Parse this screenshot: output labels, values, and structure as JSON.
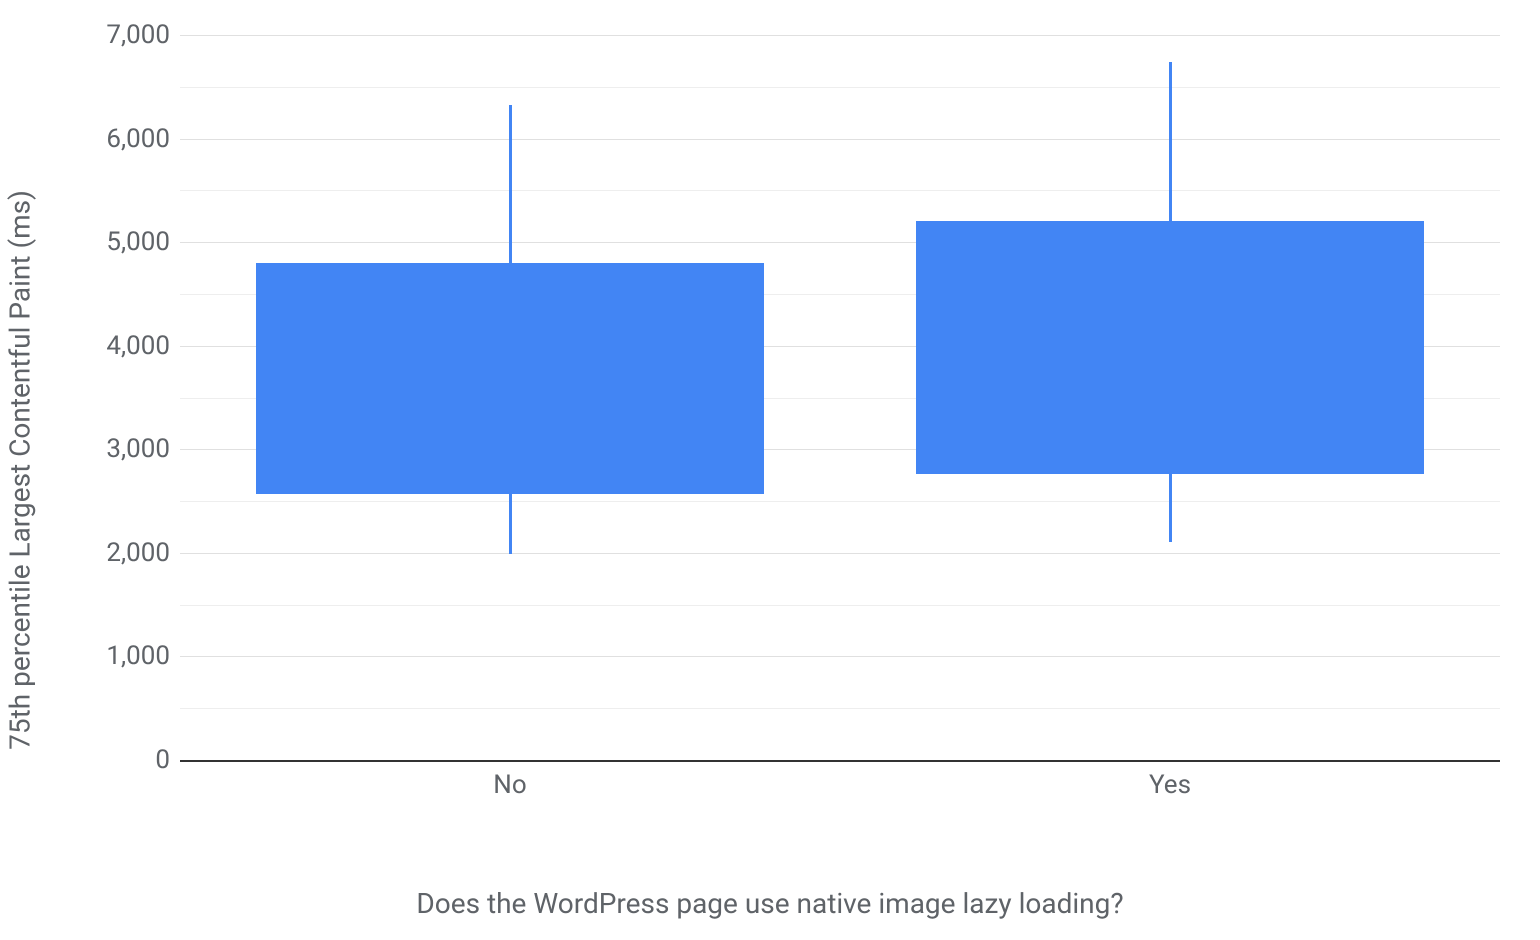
{
  "chart_data": {
    "type": "box",
    "ylabel": "75th percentile Largest Contentful Paint (ms)",
    "xlabel": "Does the WordPress page use native image lazy loading?",
    "categories": [
      "No",
      "Yes"
    ],
    "series": [
      {
        "name": "No",
        "low": 1990,
        "q1": 2570,
        "q3": 4800,
        "high": 6320
      },
      {
        "name": "Yes",
        "low": 2100,
        "q1": 2760,
        "q3": 5200,
        "high": 6740
      }
    ],
    "ylim": [
      0,
      7000
    ],
    "y_ticks_major": [
      0,
      1000,
      2000,
      3000,
      4000,
      5000,
      6000,
      7000
    ],
    "y_ticks_minor": [
      500,
      1500,
      2500,
      3500,
      4500,
      5500,
      6500
    ],
    "color": "#4285f4"
  }
}
